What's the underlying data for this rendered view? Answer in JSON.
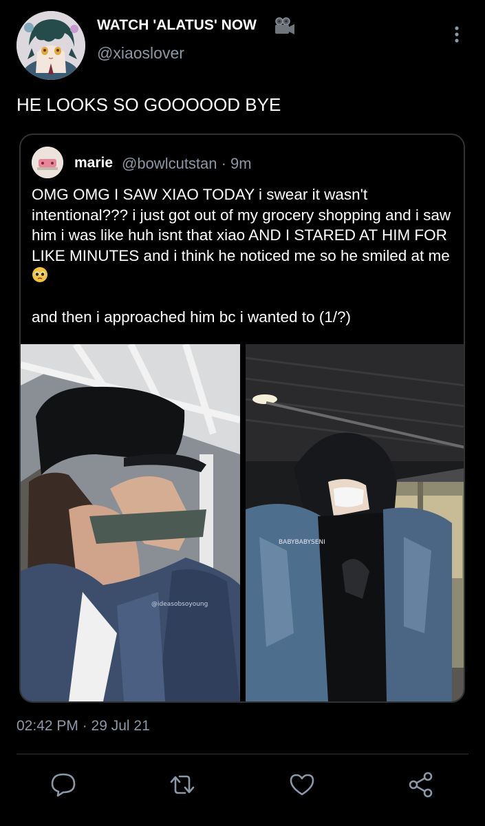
{
  "tweet": {
    "display_name": "WATCH 'ALATUS' NOW",
    "handle": "@xiaoslover",
    "text": "HE LOOKS SO GOOOOOD BYE",
    "timestamp": "02:42 PM · 29 Jul 21"
  },
  "quoted": {
    "name": "marie",
    "handle_time": "@bowlcutstan · 9m",
    "paragraph1": "OMG OMG I SAW XIAO TODAY i swear it wasn't intentional??? i just got out of my grocery shopping and i saw him i was like huh isnt that xiao AND I STARED AT HIM FOR LIKE MINUTES and i think he noticed me so he smiled at me",
    "paragraph2": "and then i approached him bc i wanted to (1/?)",
    "watermark_right": "BABYBABYSENI",
    "watermark_left": "@ideasobsoyoung"
  },
  "icons": {
    "header_emoji": "movie-camera-icon",
    "more": "more-vertical-icon",
    "text_emoji": "pleading-face-icon",
    "actions": [
      "reply-icon",
      "retweet-icon",
      "like-icon",
      "share-icon"
    ]
  },
  "colors": {
    "background": "#000000",
    "text_primary": "#ffffff",
    "text_secondary": "#8b98a5",
    "border": "#2f3336",
    "emoji_yellow": "#f4c33c"
  }
}
